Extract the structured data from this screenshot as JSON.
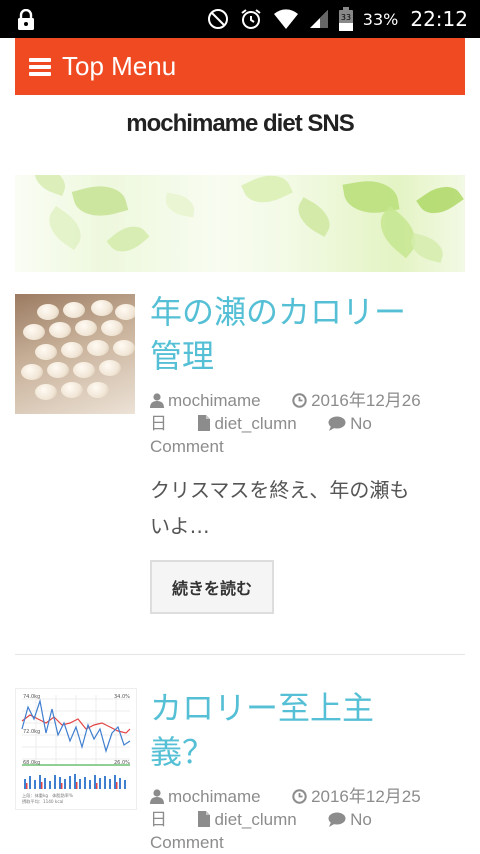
{
  "status_bar": {
    "battery_percent": "33%",
    "battery_level": "33",
    "time": "22:12"
  },
  "menu": {
    "label": "Top Menu"
  },
  "site": {
    "title": "mochimame diet SNS"
  },
  "posts": [
    {
      "title_line1": "年の瀬のカロリー",
      "title_line2": "管理",
      "author": "mochimame",
      "date_line1": "2016年12月26",
      "date_line2": "日",
      "category": "diet_clumn",
      "comments_line1": "No",
      "comments_line2": "Comment",
      "excerpt_line1": "クリスマスを終え、年の瀬も",
      "excerpt_line2": "いよ…",
      "read_more": "続きを読む"
    },
    {
      "title_line1": "カロリー至上主",
      "title_line2": "義？",
      "author": "mochimame",
      "date_line1": "2016年12月25",
      "date_line2": "日",
      "category": "diet_clumn",
      "comments_line1": "No",
      "comments_line2": "Comment",
      "chart_labels": {
        "top_left": "74.0kg",
        "top_right": "34.0%",
        "mid_left": "72.0kg",
        "low_left": "68.0kg",
        "low_right": "26.0%",
        "footer1": "上段：体重kg　体脂肪率%",
        "footer2": "摂取平均：1140 kcal"
      }
    }
  ],
  "colors": {
    "accent": "#f04a23",
    "title_link": "#55c0d5",
    "meta": "#8c8c8c"
  }
}
